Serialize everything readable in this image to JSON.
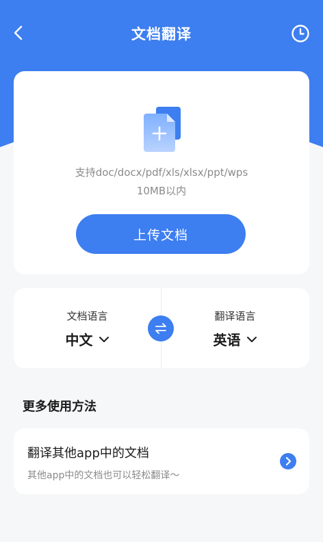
{
  "header": {
    "title": "文档翻译",
    "back_icon": "chevron-left-icon",
    "history_icon": "clock-icon"
  },
  "upload": {
    "icon": "add-document-icon",
    "formats_text": "支持doc/docx/pdf/xls/xlsx/ppt/wps",
    "size_limit_text": "10MB以内",
    "button_label": "上传文档"
  },
  "languages": {
    "source_caption": "文档语言",
    "source_value": "中文",
    "target_caption": "翻译语言",
    "target_value": "英语",
    "swap_icon": "swap-arrows-icon"
  },
  "more": {
    "section_title": "更多使用方法",
    "item_title": "翻译其他app中的文档",
    "item_desc": "其他app中的文档也可以轻松翻译～",
    "item_icon": "chevron-right-circle-icon"
  },
  "colors": {
    "accent": "#3d7ef0",
    "background": "#f6f7f9",
    "card": "#ffffff",
    "muted_text": "#8a8a8a"
  }
}
